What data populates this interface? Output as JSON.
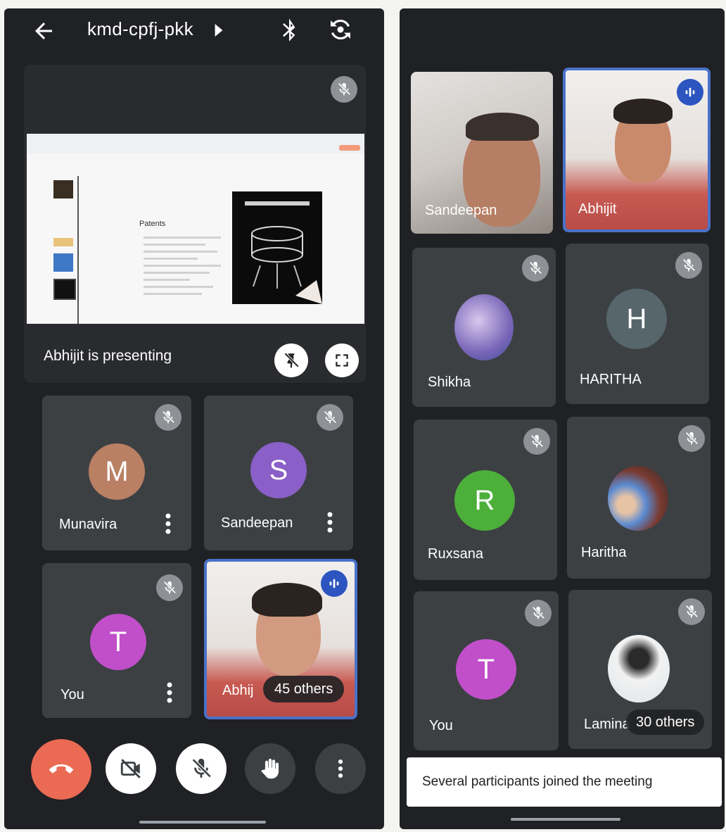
{
  "left": {
    "meeting_code": "kmd-cpfj-pkk",
    "presentation": {
      "caption": "Abhijit is presenting",
      "slide_heading": "Patents"
    },
    "tiles": [
      {
        "initial": "M",
        "name": "Munavira",
        "color": "#b98064"
      },
      {
        "initial": "S",
        "name": "Sandeepan",
        "color": "#8a5fc7"
      },
      {
        "initial": "T",
        "name": "You",
        "color": "#c04fc9"
      },
      {
        "name": "Abhij",
        "others": "45 others"
      }
    ],
    "controls": {
      "end_call_color": "#ea6a54"
    }
  },
  "right": {
    "tiles": [
      {
        "name": "Sandeepan"
      },
      {
        "name": "Abhijit"
      },
      {
        "name": "Shikha"
      },
      {
        "initial": "H",
        "name": "HARITHA",
        "color": "#56666b"
      },
      {
        "initial": "R",
        "name": "Ruxsana",
        "color": "#4caf3a"
      },
      {
        "name": "Haritha"
      },
      {
        "initial": "T",
        "name": "You",
        "color": "#c04fc9"
      },
      {
        "name": "Lamina",
        "others": "30 others"
      }
    ],
    "toast": "Several participants joined the meeting"
  },
  "colors": {
    "background": "#202124",
    "tile": "#3c4043",
    "speaking_border": "#4a72c8"
  }
}
